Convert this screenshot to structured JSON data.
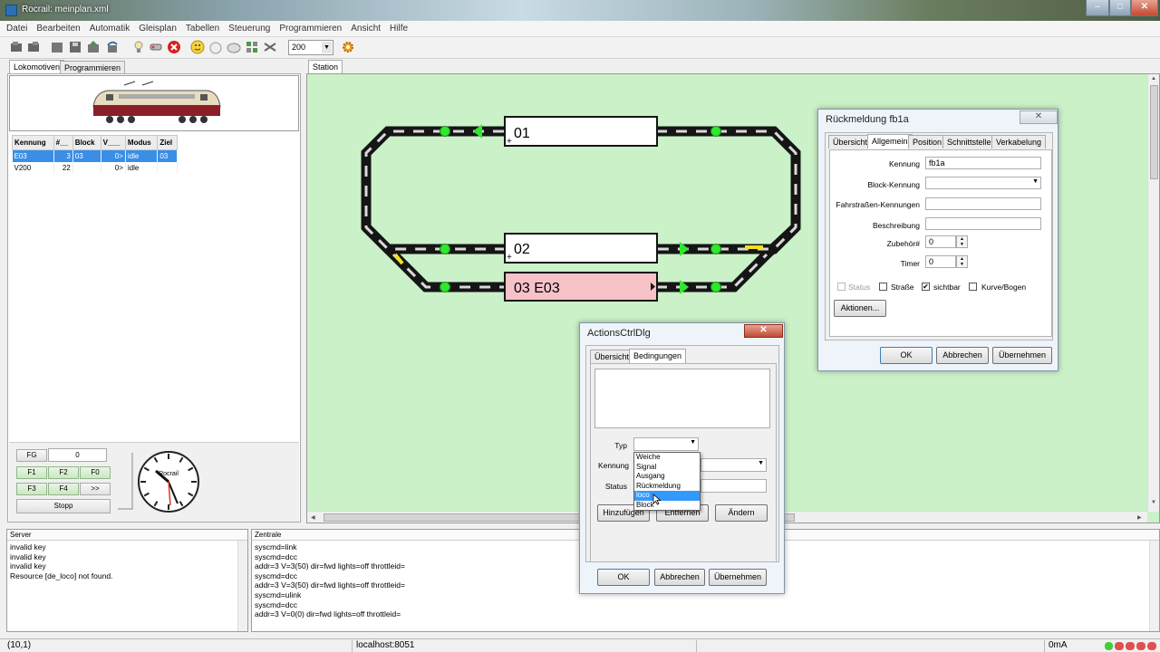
{
  "window": {
    "title": "Rocrail: meinplan.xml"
  },
  "menu": [
    "Datei",
    "Bearbeiten",
    "Automatik",
    "Gleisplan",
    "Tabellen",
    "Steuerung",
    "Programmieren",
    "Ansicht",
    "Hilfe"
  ],
  "toolbar": {
    "zoom_value": "200"
  },
  "left_tabs": [
    "Lokomotiven",
    "Programmieren"
  ],
  "loco_table": {
    "headers": [
      "Kennung",
      "#__",
      "Block",
      "V___",
      "Modus",
      "Ziel"
    ],
    "rows": [
      {
        "id": "E03",
        "addr": "3",
        "block": "03",
        "v": "0>",
        "mode": "idle",
        "dest": "03",
        "selected": true
      },
      {
        "id": "V200",
        "addr": "22",
        "block": "",
        "v": "0>",
        "mode": "idle",
        "dest": "",
        "selected": false
      }
    ]
  },
  "throttle": {
    "fg_label": "FG",
    "speed_value": "0",
    "f_buttons": [
      "F1",
      "F2",
      "F0",
      "F3",
      "F4",
      ">>"
    ],
    "stop_label": "Stopp",
    "clock_label": "Rocrail"
  },
  "station": {
    "tab_label": "Station",
    "blocks": [
      {
        "label": "01",
        "occupied": false
      },
      {
        "label": "02",
        "occupied": false
      },
      {
        "label": "03 E03",
        "occupied": true
      }
    ]
  },
  "feedback_dialog": {
    "title": "Rückmeldung fb1a",
    "tabs": [
      "Übersicht",
      "Allgemein",
      "Position",
      "Schnittstelle",
      "Verkabelung"
    ],
    "active_tab": "Allgemein",
    "labels": {
      "kennung": "Kennung",
      "block_kennung": "Block-Kennung",
      "route_ids": "Fahrstraßen-Kennungen",
      "beschreibung": "Beschreibung",
      "zubehoer": "Zubehör#",
      "timer": "Timer"
    },
    "values": {
      "kennung": "fb1a",
      "zubehoer": "0",
      "timer": "0"
    },
    "checkboxes": [
      {
        "label": "Status",
        "checked": false,
        "disabled": true
      },
      {
        "label": "Straße",
        "checked": false,
        "disabled": false
      },
      {
        "label": "sichtbar",
        "checked": true,
        "disabled": false
      },
      {
        "label": "Kurve/Bogen",
        "checked": false,
        "disabled": false
      }
    ],
    "actions_button": "Aktionen...",
    "buttons": [
      "OK",
      "Abbrechen",
      "Übernehmen"
    ]
  },
  "actions_dialog": {
    "title": "ActionsCtrlDlg",
    "tabs": [
      "Übersicht",
      "Bedingungen"
    ],
    "active_tab": "Bedingungen",
    "labels": {
      "typ": "Typ",
      "kennung": "Kennung",
      "status": "Status"
    },
    "dropdown_options": [
      "Weiche",
      "Signal",
      "Ausgang",
      "Rückmeldung",
      "loco",
      "Block"
    ],
    "highlighted_option": "loco",
    "buttons_row": [
      "Hinzufügen",
      "Entfernen",
      "Ändern"
    ],
    "buttons": [
      "OK",
      "Abbrechen",
      "Übernehmen"
    ]
  },
  "server_pane": {
    "header": "Server",
    "lines": [
      "invalid key",
      "invalid key",
      "invalid key",
      "Resource [de_loco] not found."
    ]
  },
  "central_pane": {
    "header": "Zentrale",
    "lines": [
      "syscmd=link",
      "syscmd=dcc",
      "addr=3 V=3(50) dir=fwd lights=off throttleid=",
      "syscmd=dcc",
      "addr=3 V=3(50) dir=fwd lights=off throttleid=",
      "syscmd=ulink",
      "syscmd=dcc",
      "addr=3 V=0(0) dir=fwd lights=off throttleid="
    ]
  },
  "statusbar": {
    "coords": "(10,1)",
    "host": "localhost:8051",
    "current": "0mA"
  },
  "colors": {
    "track": "#151515",
    "track_light": "#d8d8d8",
    "sensor_green": "#2ee82e",
    "block_occupied": "#f6c2c8",
    "station_bg": "#cbf1c8",
    "selection": "#3a8ee6"
  }
}
